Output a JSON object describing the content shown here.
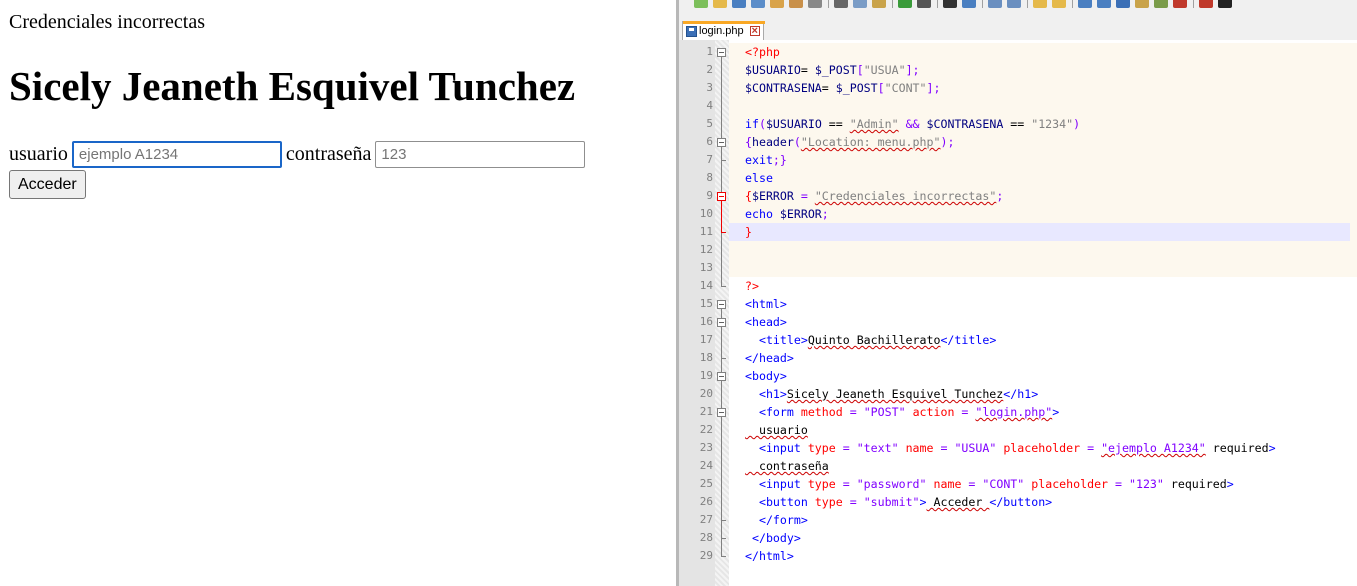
{
  "browser": {
    "message": "Credenciales incorrectas",
    "heading": "Sicely Jeaneth Esquivel Tunchez",
    "usuario_label": "usuario",
    "usuario_placeholder": "ejemplo A1234",
    "contrasena_label": "contraseña",
    "contrasena_placeholder": "123",
    "submit_label": "Acceder"
  },
  "editor": {
    "tab_title": "login.php",
    "tab_close": "×",
    "colors": {
      "current_line": "#e8e8ff",
      "php_block": "#fdf8ee",
      "tab_accent": "#f9a825"
    },
    "lines": [
      {
        "n": "1",
        "segs": [
          [
            "php",
            "<?php"
          ]
        ]
      },
      {
        "n": "2",
        "segs": [
          [
            "var",
            "$USUARIO"
          ],
          [
            "",
            "= "
          ],
          [
            "var",
            "$_POST"
          ],
          [
            "op",
            "["
          ],
          [
            "str",
            "\"USUA\""
          ],
          [
            "op",
            "];"
          ]
        ]
      },
      {
        "n": "3",
        "segs": [
          [
            "var",
            "$CONTRASENA"
          ],
          [
            "",
            "= "
          ],
          [
            "var",
            "$_POST"
          ],
          [
            "op",
            "["
          ],
          [
            "str",
            "\"CONT\""
          ],
          [
            "op",
            "];"
          ]
        ]
      },
      {
        "n": "4",
        "segs": []
      },
      {
        "n": "5",
        "segs": [
          [
            "kw",
            "if"
          ],
          [
            "op",
            "("
          ],
          [
            "var",
            "$USUARIO"
          ],
          [
            "",
            " == "
          ],
          [
            "str",
            "\"Admin\""
          ],
          [
            "op",
            " && "
          ],
          [
            "var",
            "$CONTRASENA"
          ],
          [
            "",
            " == "
          ],
          [
            "str",
            "\"1234\""
          ],
          [
            "op",
            ")"
          ]
        ]
      },
      {
        "n": "6",
        "segs": [
          [
            "op",
            "{"
          ],
          [
            "var",
            "header"
          ],
          [
            "op",
            "("
          ],
          [
            "str",
            "\"Location: menu.php\""
          ],
          [
            "op",
            ");"
          ]
        ]
      },
      {
        "n": "7",
        "segs": [
          [
            "kw",
            "exit"
          ],
          [
            "op",
            ";}"
          ]
        ]
      },
      {
        "n": "8",
        "segs": [
          [
            "kw",
            "else"
          ]
        ]
      },
      {
        "n": "9",
        "segs": [
          [
            "attr",
            "{"
          ],
          [
            "var",
            "$ERROR"
          ],
          [
            "op",
            " = "
          ],
          [
            "str",
            "\"Credenciales incorrectas\""
          ],
          [
            "op",
            ";"
          ]
        ]
      },
      {
        "n": "10",
        "segs": [
          [
            "kw",
            "echo"
          ],
          [
            "",
            " "
          ],
          [
            "var",
            "$ERROR"
          ],
          [
            "op",
            ";"
          ]
        ]
      },
      {
        "n": "11",
        "segs": [
          [
            "attr",
            "}"
          ]
        ]
      },
      {
        "n": "12",
        "segs": []
      },
      {
        "n": "13",
        "segs": []
      },
      {
        "n": "14",
        "segs": [
          [
            "php",
            "?>"
          ]
        ]
      },
      {
        "n": "15",
        "segs": [
          [
            "tag",
            "<html>"
          ]
        ]
      },
      {
        "n": "16",
        "segs": [
          [
            "tag",
            "<head>"
          ]
        ]
      },
      {
        "n": "17",
        "segs": [
          [
            "",
            ""
          ],
          [
            "tag",
            "  <title>"
          ],
          [
            "",
            "Quinto Bachillerato"
          ],
          [
            "tag",
            "</title>"
          ]
        ]
      },
      {
        "n": "18",
        "segs": [
          [
            "tag",
            "</head>"
          ]
        ]
      },
      {
        "n": "19",
        "segs": [
          [
            "tag",
            "<body>"
          ]
        ]
      },
      {
        "n": "20",
        "segs": [
          [
            "tag",
            "  <h1>"
          ],
          [
            "",
            "Sicely Jeaneth Esquivel Tunchez"
          ],
          [
            "tag",
            "</h1>"
          ]
        ]
      },
      {
        "n": "21",
        "segs": [
          [
            "tag",
            "  <form "
          ],
          [
            "attr",
            "method"
          ],
          [
            "op",
            " = "
          ],
          [
            "aval",
            "\"POST\""
          ],
          [
            "",
            " "
          ],
          [
            "attr",
            "action"
          ],
          [
            "op",
            " = "
          ],
          [
            "aval",
            "\"login.php\""
          ],
          [
            "tag",
            ">"
          ]
        ]
      },
      {
        "n": "22",
        "segs": [
          [
            "",
            "  usuario"
          ]
        ]
      },
      {
        "n": "23",
        "segs": [
          [
            "tag",
            "  <input "
          ],
          [
            "attr",
            "type"
          ],
          [
            "op",
            " = "
          ],
          [
            "aval",
            "\"text\""
          ],
          [
            "",
            " "
          ],
          [
            "attr",
            "name"
          ],
          [
            "op",
            " = "
          ],
          [
            "aval",
            "\"USUA\""
          ],
          [
            "",
            " "
          ],
          [
            "attr",
            "placeholder"
          ],
          [
            "op",
            " = "
          ],
          [
            "aval",
            "\"ejemplo A1234\""
          ],
          [
            "",
            " required"
          ],
          [
            "tag",
            ">"
          ]
        ]
      },
      {
        "n": "24",
        "segs": [
          [
            "",
            "  contraseña"
          ]
        ]
      },
      {
        "n": "25",
        "segs": [
          [
            "tag",
            "  <input "
          ],
          [
            "attr",
            "type"
          ],
          [
            "op",
            " = "
          ],
          [
            "aval",
            "\"password\""
          ],
          [
            "",
            " "
          ],
          [
            "attr",
            "name"
          ],
          [
            "op",
            " = "
          ],
          [
            "aval",
            "\"CONT\""
          ],
          [
            "",
            " "
          ],
          [
            "attr",
            "placeholder"
          ],
          [
            "op",
            " = "
          ],
          [
            "aval",
            "\"123\""
          ],
          [
            "",
            " required"
          ],
          [
            "tag",
            ">"
          ]
        ]
      },
      {
        "n": "26",
        "segs": [
          [
            "tag",
            "  <button "
          ],
          [
            "attr",
            "type"
          ],
          [
            "op",
            " = "
          ],
          [
            "aval",
            "\"submit\""
          ],
          [
            "tag",
            ">"
          ],
          [
            "",
            " Acceder "
          ],
          [
            "tag",
            "</button>"
          ]
        ]
      },
      {
        "n": "27",
        "segs": [
          [
            "tag",
            "  </form>"
          ]
        ]
      },
      {
        "n": "28",
        "segs": [
          [
            "tag",
            " </body>"
          ]
        ]
      },
      {
        "n": "29",
        "segs": [
          [
            "tag",
            "</html>"
          ]
        ]
      }
    ]
  }
}
